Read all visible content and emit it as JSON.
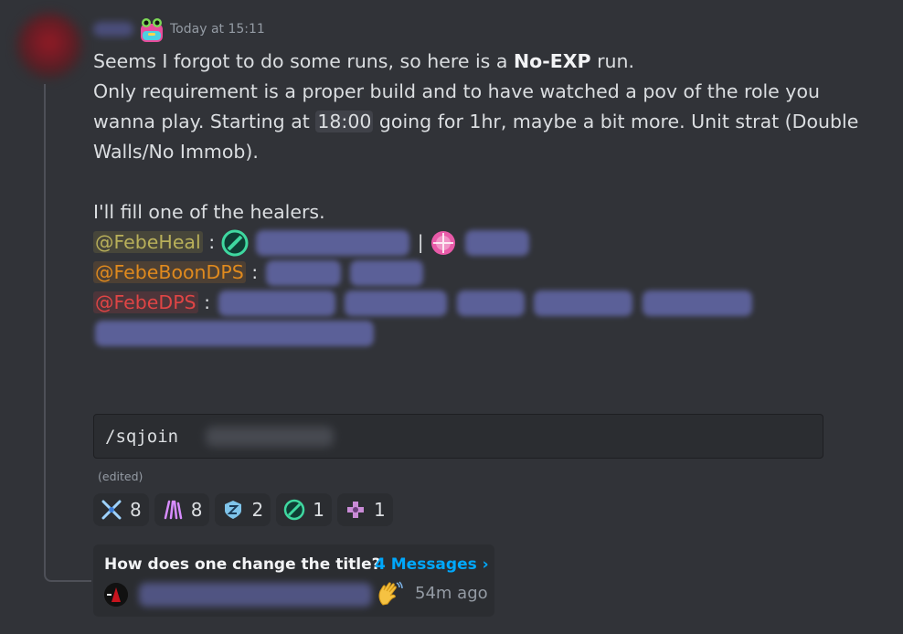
{
  "message": {
    "timestamp": "Today at 15:11",
    "line1_pre": "Seems I forgot to do some runs, so here is a ",
    "line1_bold": "No-EXP",
    "line1_post": " run.",
    "line2_pre": "Only requirement is a proper build and to have watched a pov of the role you wanna play. Starting at ",
    "line2_time": "18:00",
    "line2_post": " going for 1hr, maybe a bit more. Unit strat (Double Walls/No Immob).",
    "line3": "I'll fill one of the healers.",
    "roles": [
      {
        "label": "@FebeHeal",
        "sep": ":"
      },
      {
        "label": "@FebeBoonDPS",
        "sep": ":"
      },
      {
        "label": "@FebeDPS",
        "sep": ":"
      }
    ],
    "pipe": "|",
    "code": "/sqjoin",
    "edited": "(edited)"
  },
  "reactions": [
    {
      "icon": "crossed-swords-icon",
      "count": "8"
    },
    {
      "icon": "purple-claw-icon",
      "count": "8"
    },
    {
      "icon": "blue-shield-z-icon",
      "count": "2"
    },
    {
      "icon": "green-circle-icon",
      "count": "1"
    },
    {
      "icon": "pink-cross-icon",
      "count": "1"
    }
  ],
  "thread": {
    "title": "How does one change the title?",
    "count": "4 Messages ›",
    "time": "54m ago"
  },
  "colors": {
    "background": "#313338",
    "role_heal": "#b9b05a",
    "role_boon": "#e08a1e",
    "role_dps": "#e04545",
    "link": "#00a8fc"
  }
}
